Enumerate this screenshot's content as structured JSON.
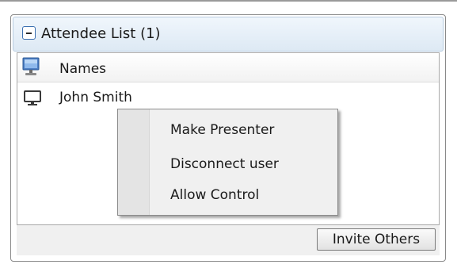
{
  "panel": {
    "title": "Attendee List (1)",
    "collapse_icon": "minus-box-icon"
  },
  "attendee_list": {
    "header_icon": "monitor-icon",
    "column_header": "Names",
    "rows": [
      {
        "icon": "monitor-outline-icon",
        "name": "John Smith"
      }
    ]
  },
  "context_menu": {
    "items": [
      {
        "label": "Make Presenter"
      },
      {
        "label": "Disconnect user"
      },
      {
        "label": "Allow Control"
      }
    ]
  },
  "footer": {
    "invite_label": "Invite Others"
  },
  "colors": {
    "header_gradient_top": "#f0f6fc",
    "header_gradient_bottom": "#dde9f4",
    "collapse_border": "#3b6fb0",
    "menu_background": "#f0f0f0",
    "footer_background": "#f0f0f0"
  }
}
